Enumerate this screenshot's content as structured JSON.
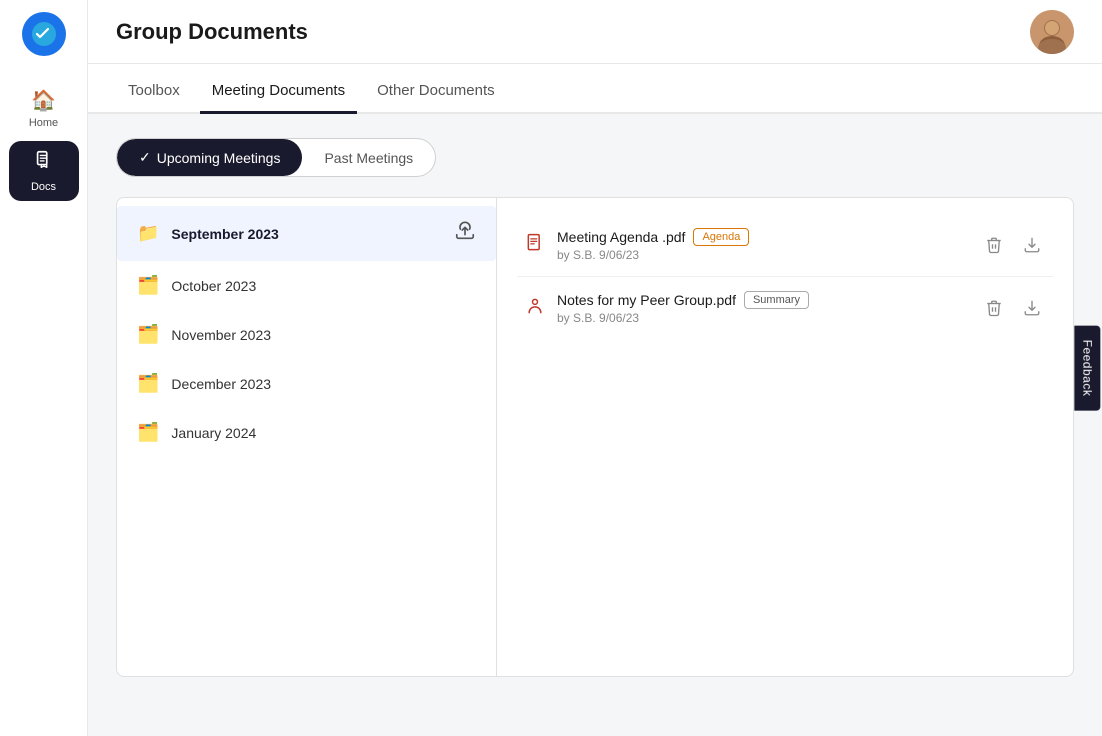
{
  "app": {
    "title": "Group Documents",
    "logo_symbol": "telegram"
  },
  "sidebar": {
    "items": [
      {
        "id": "home",
        "label": "Home",
        "icon": "🏠",
        "active": false
      },
      {
        "id": "docs",
        "label": "Docs",
        "icon": "📄",
        "active": true
      }
    ]
  },
  "header": {
    "title": "Group Documents"
  },
  "top_tabs": [
    {
      "id": "toolbox",
      "label": "Toolbox",
      "active": false
    },
    {
      "id": "meeting-documents",
      "label": "Meeting Documents",
      "active": true
    },
    {
      "id": "other-documents",
      "label": "Other Documents",
      "active": false
    }
  ],
  "sub_tabs": [
    {
      "id": "upcoming",
      "label": "Upcoming Meetings",
      "active": true,
      "has_check": true
    },
    {
      "id": "past",
      "label": "Past Meetings",
      "active": false,
      "has_check": false
    }
  ],
  "folders": [
    {
      "id": "sep-2023",
      "name": "September 2023",
      "selected": true,
      "show_upload": true
    },
    {
      "id": "oct-2023",
      "name": "October 2023",
      "selected": false,
      "show_upload": false
    },
    {
      "id": "nov-2023",
      "name": "November 2023",
      "selected": false,
      "show_upload": false
    },
    {
      "id": "dec-2023",
      "name": "December 2023",
      "selected": false,
      "show_upload": false
    },
    {
      "id": "jan-2024",
      "name": "January 2024",
      "selected": false,
      "show_upload": false
    }
  ],
  "files": [
    {
      "id": "file-1",
      "name": "Meeting Agenda .pdf",
      "badge": "Agenda",
      "badge_type": "agenda",
      "meta": "by S.B. 9/06/23",
      "icon_type": "list"
    },
    {
      "id": "file-2",
      "name": "Notes for my Peer Group.pdf",
      "badge": "Summary",
      "badge_type": "summary",
      "meta": "by S.B. 9/06/23",
      "icon_type": "person"
    }
  ],
  "actions": {
    "delete_label": "delete",
    "download_label": "download",
    "upload_label": "upload"
  },
  "feedback": {
    "label": "Feedback"
  }
}
